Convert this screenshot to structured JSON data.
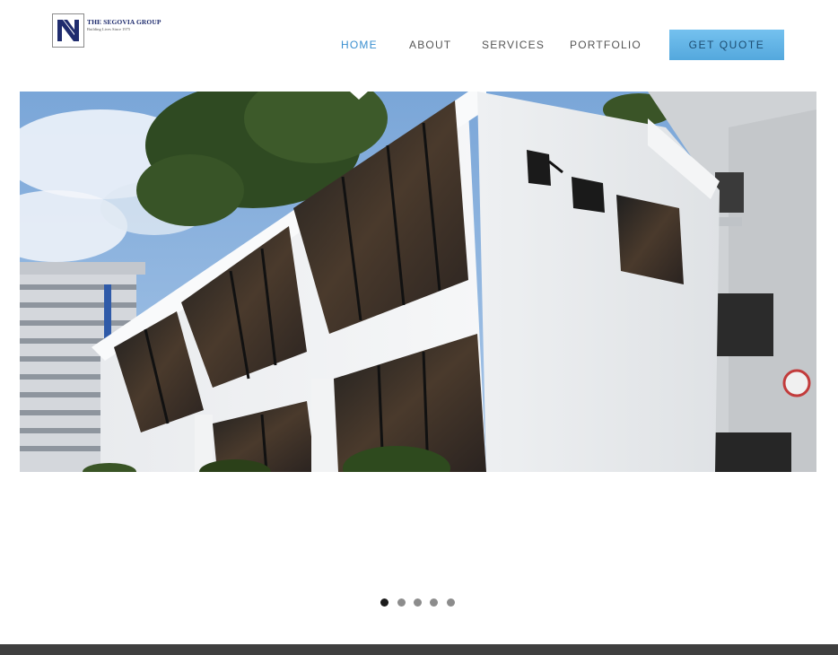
{
  "brand": {
    "title": "THE SEGOVIA GROUP",
    "tagline": "Building Lives Since 1975",
    "colors": {
      "navy": "#1f2c6e",
      "accent": "#3a8fd0",
      "button": "#5fb3e6"
    }
  },
  "nav": {
    "items": [
      {
        "label": "HOME",
        "active": true
      },
      {
        "label": "ABOUT",
        "active": false
      },
      {
        "label": "SERVICES",
        "active": false
      },
      {
        "label": "PORTFOLIO",
        "active": false
      }
    ],
    "cta_label": "GET QUOTE"
  },
  "slider": {
    "slide_count": 5,
    "current_slide": 1,
    "image": "white-modern-building-photo"
  }
}
